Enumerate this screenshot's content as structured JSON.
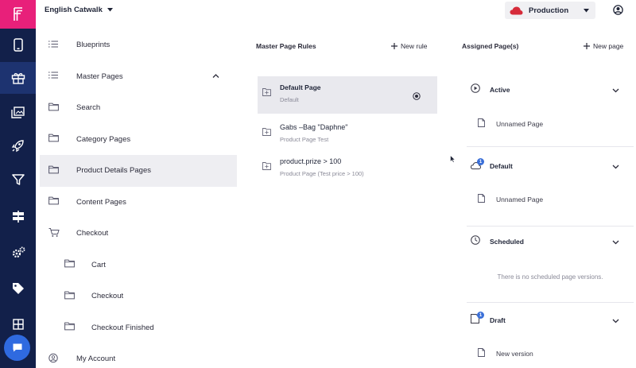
{
  "brand": {
    "logo_letter": "F",
    "accent": "#e8207a",
    "rail_color": "#12204a"
  },
  "header": {
    "site_name": "English Catwalk",
    "environment": "Production",
    "environment_color": "#d62b3a"
  },
  "rail": [
    {
      "icon": "mobile-icon"
    },
    {
      "icon": "gift-icon",
      "active": true
    },
    {
      "icon": "gallery-icon"
    },
    {
      "icon": "rocket-icon"
    },
    {
      "icon": "filter-icon"
    },
    {
      "icon": "signpost-icon"
    },
    {
      "icon": "gears-icon"
    },
    {
      "icon": "tag-icon"
    },
    {
      "icon": "grid-icon"
    },
    {
      "icon": "chat-icon"
    }
  ],
  "nav": {
    "items": [
      {
        "label": "Blueprints",
        "icon": "list-icon"
      },
      {
        "label": "Master Pages",
        "icon": "list-icon",
        "expanded": true
      },
      {
        "label": "Search",
        "icon": "folder-icon"
      },
      {
        "label": "Category Pages",
        "icon": "folder-icon"
      },
      {
        "label": "Product Details Pages",
        "icon": "folder-icon",
        "selected": true
      },
      {
        "label": "Content Pages",
        "icon": "folder-icon"
      },
      {
        "label": "Checkout",
        "icon": "cart-icon"
      },
      {
        "label": "Cart",
        "icon": "folder-icon",
        "sub": true
      },
      {
        "label": "Checkout",
        "icon": "folder-icon",
        "sub": true
      },
      {
        "label": "Checkout Finished",
        "icon": "folder-icon",
        "sub": true
      },
      {
        "label": "My Account",
        "icon": "account-icon"
      }
    ]
  },
  "rules": {
    "title": "Master Page Rules",
    "new_label": "New rule",
    "items": [
      {
        "title": "Default Page",
        "subtitle": "Default",
        "selected": true
      },
      {
        "title": "Gabs –Bag \"Daphne\"",
        "subtitle": "Product Page Test"
      },
      {
        "title": "product.prize > 100",
        "subtitle": "Product Page (Test price > 100)"
      }
    ]
  },
  "assigned": {
    "title": "Assigned Page(s)",
    "new_label": "New page",
    "sections": {
      "active": {
        "label": "Active",
        "page": "Unnamed Page"
      },
      "default": {
        "label": "Default",
        "page": "Unnamed Page",
        "badge": "1"
      },
      "scheduled": {
        "label": "Scheduled",
        "empty": "There is no scheduled page versions."
      },
      "draft": {
        "label": "Draft",
        "page": "New version",
        "badge": "1"
      }
    }
  }
}
